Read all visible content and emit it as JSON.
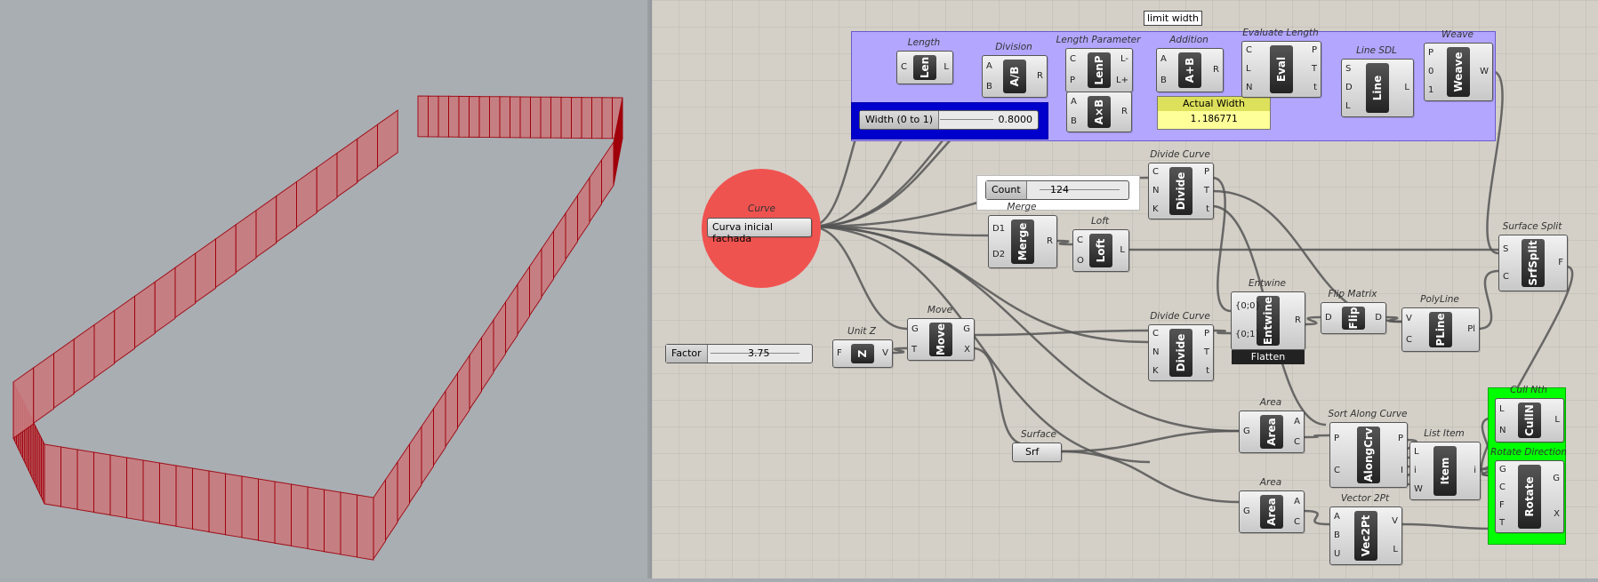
{
  "canvas": {
    "tooltip": "limit width",
    "components": {
      "length": {
        "caption": "Length",
        "core": "Len",
        "inputs": [
          "C"
        ],
        "outputs": [
          "L"
        ]
      },
      "division": {
        "caption": "Division",
        "core": "A/B",
        "inputs": [
          "A",
          "B"
        ],
        "outputs": [
          "R"
        ]
      },
      "length_param": {
        "caption": "Length Parameter",
        "core": "LenP",
        "inputs": [
          "C",
          "P"
        ],
        "outputs": [
          "L-",
          "L+"
        ]
      },
      "addition": {
        "caption": "Addition",
        "core": "A+B",
        "inputs": [
          "A",
          "B"
        ],
        "outputs": [
          "R"
        ]
      },
      "mult": {
        "caption": "",
        "core": "A×B",
        "inputs": [
          "A",
          "B"
        ],
        "outputs": [
          "R"
        ]
      },
      "eval_length": {
        "caption": "Evaluate Length",
        "core": "Eval",
        "inputs": [
          "C",
          "L",
          "N"
        ],
        "outputs": [
          "P",
          "T",
          "t"
        ]
      },
      "line_sdl": {
        "caption": "Line SDL",
        "core": "Line",
        "inputs": [
          "S",
          "D",
          "L"
        ],
        "outputs": [
          "L"
        ]
      },
      "weave": {
        "caption": "Weave",
        "core": "Weave",
        "inputs": [
          "P",
          "0",
          "1"
        ],
        "outputs": [
          "W"
        ]
      },
      "divide_curve_1": {
        "caption": "Divide Curve",
        "core": "Divide",
        "inputs": [
          "C",
          "N",
          "K"
        ],
        "outputs": [
          "P",
          "T",
          "t"
        ]
      },
      "merge": {
        "caption": "Merge",
        "core": "Merge",
        "inputs": [
          "D1",
          "D2"
        ],
        "outputs": [
          "R"
        ]
      },
      "loft": {
        "caption": "Loft",
        "core": "Loft",
        "inputs": [
          "C",
          "O"
        ],
        "outputs": [
          "L"
        ]
      },
      "surface_split": {
        "caption": "Surface Split",
        "core": "SrfSplit",
        "inputs": [
          "S",
          "C"
        ],
        "outputs": [
          "F"
        ]
      },
      "entwine": {
        "caption": "Entwine",
        "core": "Entwine",
        "inputs": [
          "{0;0}",
          "{0;1}"
        ],
        "outputs": [
          "R"
        ],
        "footer": "Flatten"
      },
      "flip_matrix": {
        "caption": "Flip Matrix",
        "core": "Flip",
        "inputs": [
          "D"
        ],
        "outputs": [
          "D"
        ]
      },
      "polyline": {
        "caption": "PolyLine",
        "core": "PLine",
        "inputs": [
          "V",
          "C"
        ],
        "outputs": [
          "Pl"
        ]
      },
      "unit_z": {
        "caption": "Unit Z",
        "core": "Z",
        "inputs": [
          "F"
        ],
        "outputs": [
          "V"
        ]
      },
      "move": {
        "caption": "Move",
        "core": "Move",
        "inputs": [
          "G",
          "T"
        ],
        "outputs": [
          "G",
          "X"
        ]
      },
      "divide_curve_2": {
        "caption": "Divide Curve",
        "core": "Divide",
        "inputs": [
          "C",
          "N",
          "K"
        ],
        "outputs": [
          "P",
          "T",
          "t"
        ]
      },
      "area_1": {
        "caption": "Area",
        "core": "Area",
        "inputs": [
          "G"
        ],
        "outputs": [
          "A",
          "C"
        ]
      },
      "area_2": {
        "caption": "Area",
        "core": "Area",
        "inputs": [
          "G"
        ],
        "outputs": [
          "A",
          "C"
        ]
      },
      "sort_along": {
        "caption": "Sort Along Curve",
        "core": "AlongCrv",
        "inputs": [
          "P",
          "C"
        ],
        "outputs": [
          "P",
          "I"
        ]
      },
      "list_item": {
        "caption": "List Item",
        "core": "Item",
        "inputs": [
          "L",
          "i",
          "W"
        ],
        "outputs": [
          "i"
        ]
      },
      "cull_nth": {
        "caption": "Cull Nth",
        "core": "CullN",
        "inputs": [
          "L",
          "N"
        ],
        "outputs": [
          "L"
        ]
      },
      "rotate_dir": {
        "caption": "Rotate Direction",
        "core": "Rotate",
        "inputs": [
          "G",
          "C",
          "F",
          "T"
        ],
        "outputs": [
          "G",
          "X"
        ]
      },
      "vector_2pt": {
        "caption": "Vector 2Pt",
        "core": "Vec2Pt",
        "inputs": [
          "A",
          "B",
          "U"
        ],
        "outputs": [
          "V",
          "L"
        ]
      }
    },
    "curve_param": {
      "caption": "Curve",
      "label": "Curva inicial fachada"
    },
    "surface_param": {
      "caption": "Surface",
      "label": "Srf"
    },
    "sliders": {
      "width": {
        "label": "Width (0 to 1)",
        "value": "0.8000"
      },
      "count": {
        "label": "Count",
        "value": "124"
      },
      "factor": {
        "label": "Factor",
        "value": "3.75"
      }
    },
    "panel": {
      "title": "Actual Width",
      "value": "1.186771"
    },
    "colors": {
      "group_purple": "#b3a6ff",
      "group_blue": "#0000cc",
      "group_green": "#00ff00",
      "curve_circle": "#ef5350"
    }
  }
}
